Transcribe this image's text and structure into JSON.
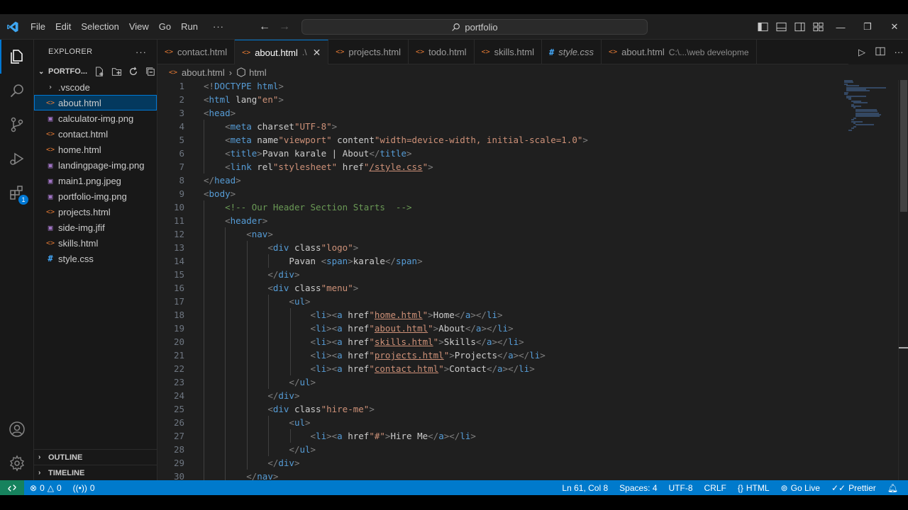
{
  "menu": [
    "File",
    "Edit",
    "Selection",
    "View",
    "Go",
    "Run",
    "···"
  ],
  "search": {
    "text": "portfolio"
  },
  "explorer": {
    "title": "EXPLORER",
    "more": "···",
    "folder": "PORTFO...",
    "items": [
      {
        "name": ".vscode",
        "type": "folder"
      },
      {
        "name": "about.html",
        "type": "html",
        "selected": true
      },
      {
        "name": "calculator-img.png",
        "type": "img"
      },
      {
        "name": "contact.html",
        "type": "html"
      },
      {
        "name": "home.html",
        "type": "html"
      },
      {
        "name": "landingpage-img.png",
        "type": "img"
      },
      {
        "name": "main1.png.jpeg",
        "type": "img"
      },
      {
        "name": "portfolio-img.png",
        "type": "img"
      },
      {
        "name": "projects.html",
        "type": "html"
      },
      {
        "name": "side-img.jfif",
        "type": "img"
      },
      {
        "name": "skills.html",
        "type": "html"
      },
      {
        "name": "style.css",
        "type": "css"
      }
    ],
    "outline": "OUTLINE",
    "timeline": "TIMELINE"
  },
  "tabs": [
    {
      "label": "contact.html",
      "type": "html"
    },
    {
      "label": "about.html",
      "type": "html",
      "active": true,
      "desc": ".\\"
    },
    {
      "label": "projects.html",
      "type": "html"
    },
    {
      "label": "todo.html",
      "type": "html"
    },
    {
      "label": "skills.html",
      "type": "html"
    },
    {
      "label": "style.css",
      "type": "css",
      "italic": true
    },
    {
      "label": "about.html",
      "type": "html",
      "desc": "C:\\...\\web developme"
    }
  ],
  "breadcrumb": {
    "file": "about.html",
    "node": "html"
  },
  "editor": {
    "lines": [
      "<!DOCTYPE html>",
      "<html lang=\"en\">",
      "<head>",
      "    <meta charset=\"UTF-8\">",
      "    <meta name=\"viewport\" content=\"width=device-width, initial-scale=1.0\">",
      "    <title>Pavan karale | About</title>",
      "    <link rel=\"stylesheet\" href=\"/style.css\">",
      "</head>",
      "<body>",
      "    <!-- Our Header Section Starts  -->",
      "    <header>",
      "        <nav>",
      "            <div class=\"logo\">",
      "                Pavan <span>karale</span>",
      "            </div>",
      "            <div class=\"menu\">",
      "                <ul>",
      "                    <li><a href=\"home.html\">Home</a></li>",
      "                    <li><a href=\"about.html\">About</a></li>",
      "                    <li><a href=\"skills.html\">Skills</a></li>",
      "                    <li><a href=\"projects.html\">Projects</a></li>",
      "                    <li><a href=\"contact.html\">Contact</a></li>",
      "                </ul>",
      "            </div>",
      "            <div class=\"hire-me\">",
      "                <ul>",
      "                    <li><a href=\"#\">Hire Me</a></li>",
      "                </ul>",
      "            </div>",
      "        </nav>"
    ]
  },
  "status": {
    "errors": "0",
    "warnings": "0",
    "ports": "0",
    "position": "Ln 61, Col 8",
    "spaces": "Spaces: 4",
    "encoding": "UTF-8",
    "eol": "CRLF",
    "language": "HTML",
    "golive": "Go Live",
    "prettier": "Prettier"
  },
  "badges": {
    "extensions": "1"
  },
  "colors": {
    "accent": "#0078d4",
    "statusbar": "#007acc",
    "remote": "#16825d"
  }
}
